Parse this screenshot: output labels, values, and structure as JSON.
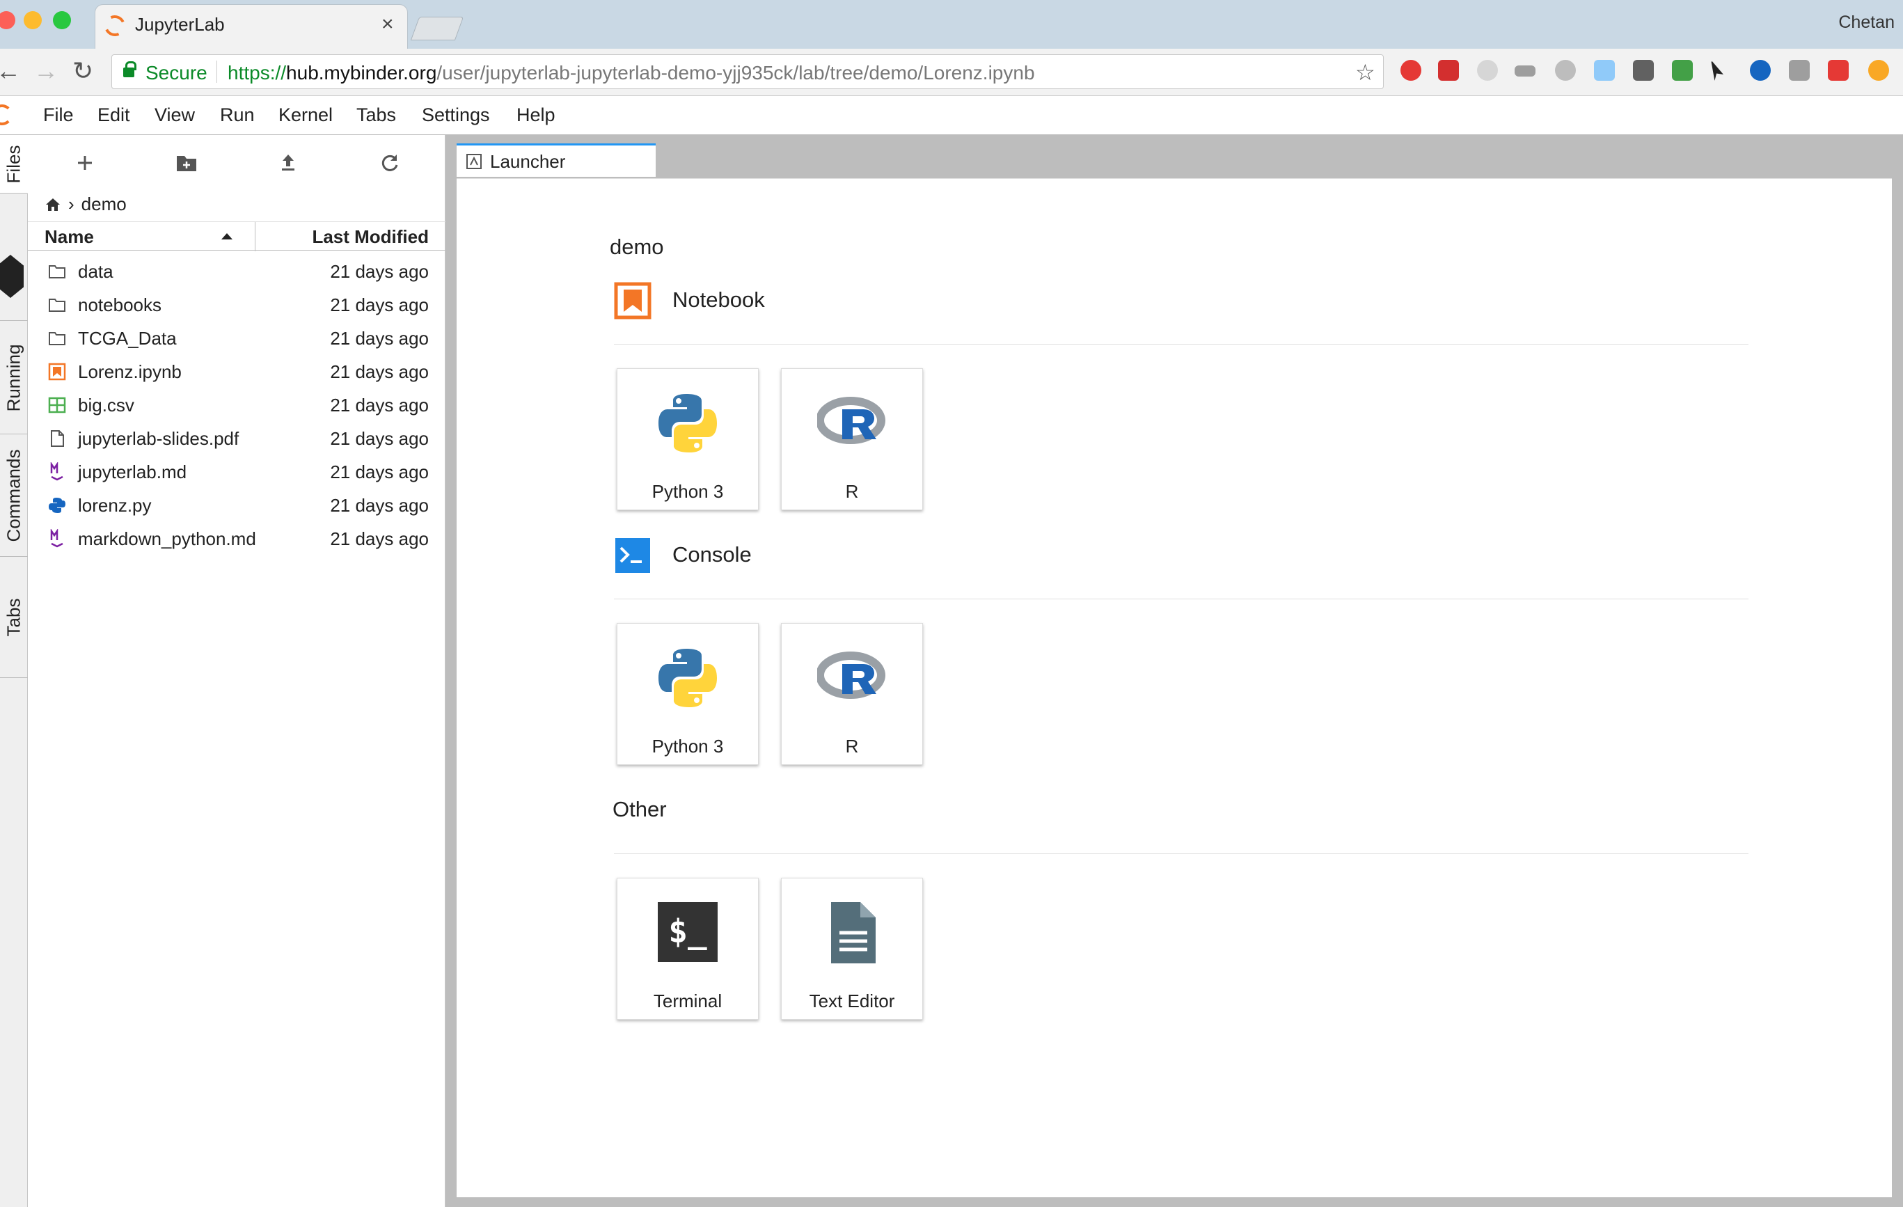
{
  "browser": {
    "tab_title": "JupyterLab",
    "tab_close": "×",
    "profile_name": "Chetan",
    "secure_label": "Secure",
    "url_scheme": "https://",
    "url_host": "hub.mybinder.org",
    "url_path": "/user/jupyterlab-jupyterlab-demo-yjj935ck/lab/tree/demo/Lorenz.ipynb",
    "back_glyph": "←",
    "forward_glyph": "→",
    "reload_glyph": "↻",
    "star_glyph": "☆",
    "extensions": [
      "opera-icon",
      "cors-icon",
      "feather-icon",
      "w-icon",
      "lock-circle-icon",
      "aot-icon",
      "w-square-icon",
      "k-icon",
      "cursor-icon",
      "search-icon",
      "cloud-icon",
      "bug-icon",
      "alert-icon"
    ]
  },
  "menu": {
    "items": [
      "File",
      "Edit",
      "View",
      "Run",
      "Kernel",
      "Tabs",
      "Settings",
      "Help"
    ]
  },
  "left_tabs": [
    "Files",
    "Running",
    "Commands",
    "Tabs"
  ],
  "file_browser": {
    "breadcrumb": "demo",
    "breadcrumb_sep": "›",
    "col_name": "Name",
    "col_modified": "Last Modified",
    "files": [
      {
        "name": "data",
        "modified": "21 days ago",
        "icon": "folder-icon"
      },
      {
        "name": "notebooks",
        "modified": "21 days ago",
        "icon": "folder-icon"
      },
      {
        "name": "TCGA_Data",
        "modified": "21 days ago",
        "icon": "folder-icon"
      },
      {
        "name": "Lorenz.ipynb",
        "modified": "21 days ago",
        "icon": "notebook-icon"
      },
      {
        "name": "big.csv",
        "modified": "21 days ago",
        "icon": "spreadsheet-icon"
      },
      {
        "name": "jupyterlab-slides.pdf",
        "modified": "21 days ago",
        "icon": "file-icon"
      },
      {
        "name": "jupyterlab.md",
        "modified": "21 days ago",
        "icon": "markdown-icon"
      },
      {
        "name": "lorenz.py",
        "modified": "21 days ago",
        "icon": "python-file-icon"
      },
      {
        "name": "markdown_python.md",
        "modified": "21 days ago",
        "icon": "markdown-icon"
      }
    ]
  },
  "launcher": {
    "tab_label": "Launcher",
    "cwd": "demo",
    "sections": [
      {
        "title": "Notebook",
        "cards": [
          {
            "label": "Python 3",
            "icon": "python-logo-icon"
          },
          {
            "label": "R",
            "icon": "r-logo-icon"
          }
        ]
      },
      {
        "title": "Console",
        "cards": [
          {
            "label": "Python 3",
            "icon": "python-logo-icon"
          },
          {
            "label": "R",
            "icon": "r-logo-icon"
          }
        ]
      },
      {
        "title": "Other",
        "cards": [
          {
            "label": "Terminal",
            "icon": "terminal-icon"
          },
          {
            "label": "Text Editor",
            "icon": "text-editor-icon"
          }
        ]
      }
    ],
    "terminal_glyph": "$_"
  },
  "colors": {
    "jupyter_orange": "#f37626",
    "active_tab_accent": "#2196f3",
    "secure_green": "#0b8a28",
    "console_blue": "#1e88e5",
    "markdown_purple": "#7b1fa2",
    "csv_green": "#4caf50"
  }
}
